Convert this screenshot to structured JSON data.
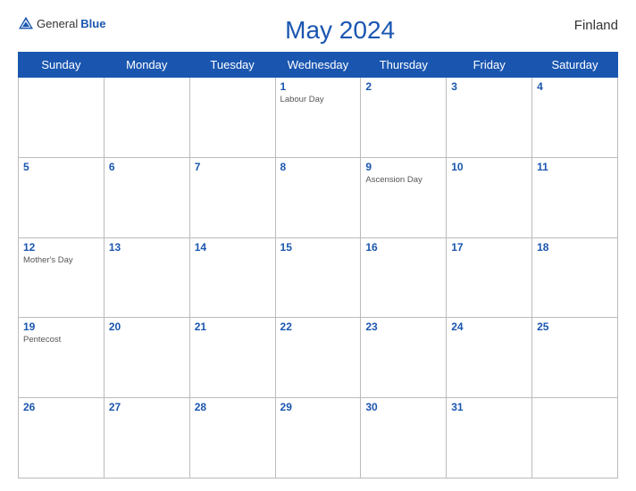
{
  "header": {
    "logo": {
      "general": "General",
      "blue": "Blue",
      "icon_title": "GeneralBlue logo"
    },
    "title": "May 2024",
    "country": "Finland"
  },
  "weekdays": [
    "Sunday",
    "Monday",
    "Tuesday",
    "Wednesday",
    "Thursday",
    "Friday",
    "Saturday"
  ],
  "weeks": [
    [
      {
        "num": "",
        "holiday": ""
      },
      {
        "num": "",
        "holiday": ""
      },
      {
        "num": "",
        "holiday": ""
      },
      {
        "num": "1",
        "holiday": "Labour Day"
      },
      {
        "num": "2",
        "holiday": ""
      },
      {
        "num": "3",
        "holiday": ""
      },
      {
        "num": "4",
        "holiday": ""
      }
    ],
    [
      {
        "num": "5",
        "holiday": ""
      },
      {
        "num": "6",
        "holiday": ""
      },
      {
        "num": "7",
        "holiday": ""
      },
      {
        "num": "8",
        "holiday": ""
      },
      {
        "num": "9",
        "holiday": "Ascension Day"
      },
      {
        "num": "10",
        "holiday": ""
      },
      {
        "num": "11",
        "holiday": ""
      }
    ],
    [
      {
        "num": "12",
        "holiday": "Mother's Day"
      },
      {
        "num": "13",
        "holiday": ""
      },
      {
        "num": "14",
        "holiday": ""
      },
      {
        "num": "15",
        "holiday": ""
      },
      {
        "num": "16",
        "holiday": ""
      },
      {
        "num": "17",
        "holiday": ""
      },
      {
        "num": "18",
        "holiday": ""
      }
    ],
    [
      {
        "num": "19",
        "holiday": "Pentecost"
      },
      {
        "num": "20",
        "holiday": ""
      },
      {
        "num": "21",
        "holiday": ""
      },
      {
        "num": "22",
        "holiday": ""
      },
      {
        "num": "23",
        "holiday": ""
      },
      {
        "num": "24",
        "holiday": ""
      },
      {
        "num": "25",
        "holiday": ""
      }
    ],
    [
      {
        "num": "26",
        "holiday": ""
      },
      {
        "num": "27",
        "holiday": ""
      },
      {
        "num": "28",
        "holiday": ""
      },
      {
        "num": "29",
        "holiday": ""
      },
      {
        "num": "30",
        "holiday": ""
      },
      {
        "num": "31",
        "holiday": ""
      },
      {
        "num": "",
        "holiday": ""
      }
    ]
  ],
  "colors": {
    "header_bg": "#1a56b0",
    "accent": "#1a56b0"
  }
}
